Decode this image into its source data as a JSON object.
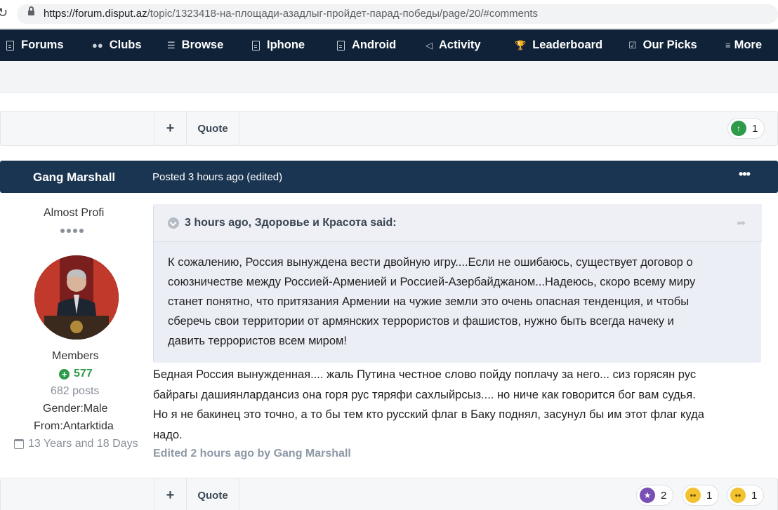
{
  "browser": {
    "url_host": "https://forum.disput.az",
    "url_path": "/topic/1323418-на-площади-азадлыг-пройдет-парад-победы/page/20/#comments"
  },
  "nav": {
    "items": [
      {
        "label": "Forums",
        "icon": "document-icon"
      },
      {
        "label": "Clubs",
        "icon": "users-icon"
      },
      {
        "label": "Browse",
        "icon": "list-icon"
      },
      {
        "label": "Iphone",
        "icon": "document-icon"
      },
      {
        "label": "Android",
        "icon": "document-icon"
      },
      {
        "label": "Activity",
        "icon": "megaphone-icon"
      },
      {
        "label": "Leaderboard",
        "icon": "trophy-icon"
      },
      {
        "label": "Our Picks",
        "icon": "checkbox-icon"
      },
      {
        "label": "More",
        "icon": "menu-icon"
      }
    ]
  },
  "top_actions": {
    "plus_label": "+",
    "quote_label": "Quote",
    "upvote_count": "1"
  },
  "post": {
    "author": "Gang Marshall",
    "posted": "Posted 3 hours ago (edited)",
    "menu_label": "•••",
    "rank_title": "Almost Profi",
    "group": "Members",
    "reputation": "577",
    "posts": "682 posts",
    "gender": "Gender:Male",
    "from": "From:Antarktida",
    "member_since": "13 Years and 18 Days",
    "quote": {
      "header": "3 hours ago, Здоровье и Красота said:",
      "lines": [
        "К сожалению, Россия вынуждена вести двойную игру....Если не ошибаюсь, существует договор о",
        "союзничестве между Россией-Арменией и Россией-Азербайджаном...Надеюсь, скоро всему миру",
        "станет понятно, что притязания Армении на чужие земли это очень опасная тенденция, и чтобы",
        "сберечь свои территории от армянских террористов и фашистов, нужно быть всегда начеку и",
        "давить террористов всем миром!"
      ]
    },
    "body_lines": [
      "Бедная Россия вынужденная.... жаль Путина честное слово пойду поплачу за него... сиз горясян рус",
      "байрагы дашиянлардансиз она горя рус тяряфи сахлыйрсыз.... но ниче как говорится бог вам судья.",
      "Но я не бакинец это точно, а то бы тем кто русский флаг в Баку поднял, засунул  бы им этот флаг куда",
      "надо."
    ],
    "edited": "Edited 2 hours ago by Gang Marshall"
  },
  "bottom_actions": {
    "plus_label": "+",
    "quote_label": "Quote",
    "reactions": [
      {
        "icon": "trophy-reaction-icon",
        "count": "2",
        "color": "#7a4fb3"
      },
      {
        "icon": "confused-reaction-icon",
        "count": "1",
        "color": "#f2c230"
      },
      {
        "icon": "sad-reaction-icon",
        "count": "1",
        "color": "#f2c230"
      }
    ]
  }
}
